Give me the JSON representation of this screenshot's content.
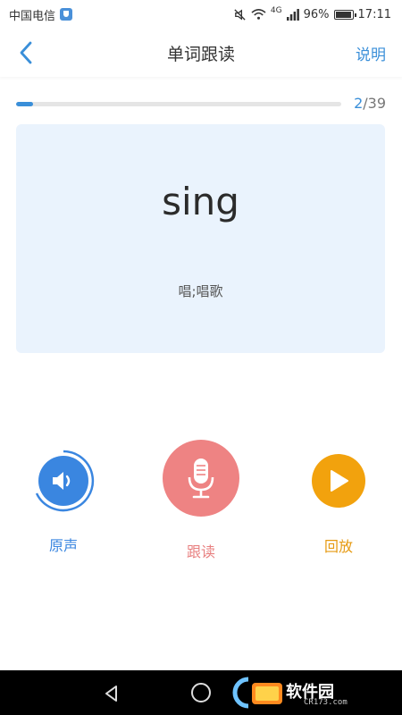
{
  "status_bar": {
    "carrier": "中国电信",
    "network": "4G",
    "battery": "96%",
    "time": "17:11"
  },
  "nav": {
    "title": "单词跟读",
    "help_label": "说明",
    "back_icon": "chevron-left-icon"
  },
  "progress": {
    "current": "2",
    "total": "/39",
    "fraction": 0.051
  },
  "word_card": {
    "word": "sing",
    "meaning": "唱;唱歌"
  },
  "controls": {
    "original_label": "原声",
    "follow_label": "跟读",
    "playback_label": "回放"
  },
  "watermark": {
    "text": "软件园",
    "sub": "CR173.com"
  },
  "colors": {
    "accent": "#3a8fd9",
    "card_bg": "#eaf3fd",
    "follow": "#ee8383",
    "playback": "#f2a20d"
  }
}
